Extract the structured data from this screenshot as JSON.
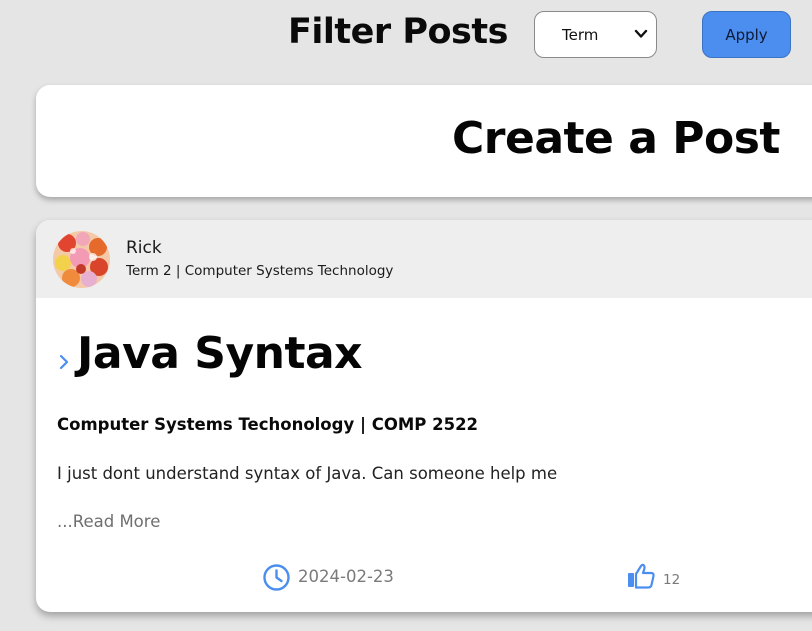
{
  "filter": {
    "title": "Filter Posts",
    "select_value": "Term",
    "apply_label": "Apply"
  },
  "create_post": {
    "title": "Create a Post"
  },
  "post": {
    "author_name": "Rick",
    "author_meta": "Term 2 | Computer Systems Technology",
    "title": "Java Syntax",
    "course": "Computer Systems Techonology | COMP 2522",
    "body": "I just dont understand syntax of Java. Can someone help me",
    "read_more": "...Read More",
    "date": "2024-02-23",
    "likes": "12"
  },
  "colors": {
    "accent": "#4b8ef0",
    "background": "#e5e5e5",
    "card": "#ffffff",
    "header": "#eeeeee"
  },
  "icons": {
    "select_chevron": "chevron-down-icon",
    "expand": "chevron-right-icon",
    "date": "clock-icon",
    "like": "thumbs-up-icon"
  }
}
